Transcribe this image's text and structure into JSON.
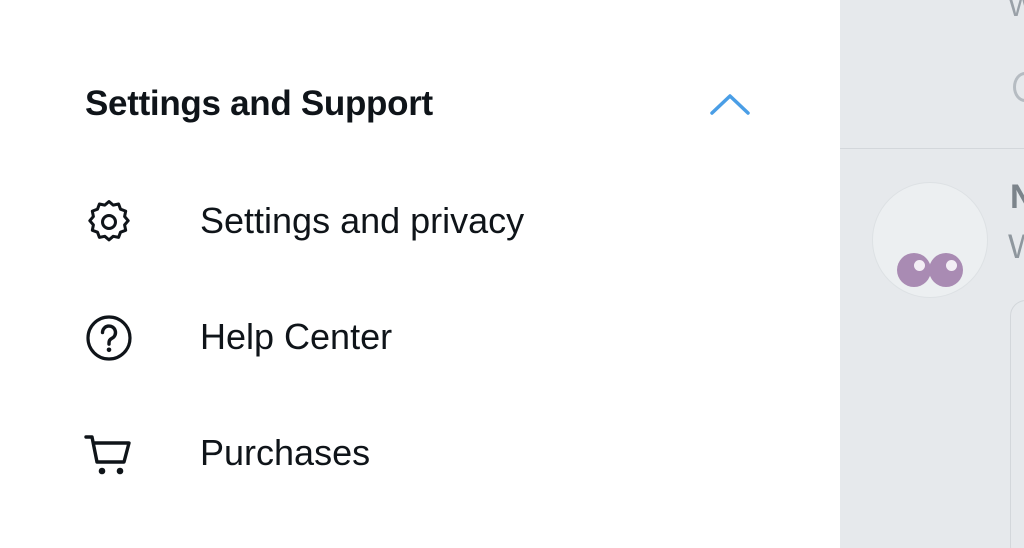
{
  "drawer": {
    "section": {
      "title": "Settings and Support",
      "expanded": true,
      "toggle_icon": "chevron-up-icon",
      "accent_color": "#4a9ee6"
    },
    "items": [
      {
        "label": "Settings and privacy",
        "icon": "gear-icon"
      },
      {
        "label": "Help Center",
        "icon": "help-circle-icon"
      },
      {
        "label": "Purchases",
        "icon": "cart-icon"
      }
    ]
  },
  "background": {
    "top_partial_text": "W",
    "post_author_partial": "N",
    "post_text_partial": "W",
    "avatar": "eyes-emoji-avatar"
  }
}
